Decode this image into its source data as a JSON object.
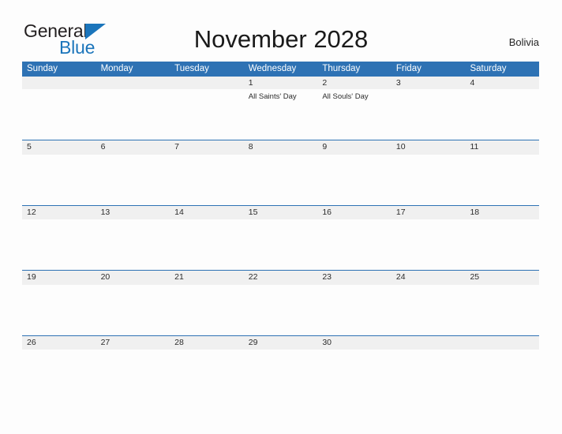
{
  "brand": {
    "name_part1": "General",
    "name_part2": "Blue",
    "triangle_icon": "blue-triangle-icon",
    "color_dark": "#231f20",
    "color_blue": "#1b75bb"
  },
  "header": {
    "title": "November 2028",
    "region": "Bolivia"
  },
  "theme": {
    "header_blue": "#2e72b4",
    "band_gray": "#f0f0f0",
    "page_background": "#fdfdfd",
    "text_dark": "#2b2b2b"
  },
  "calendar": {
    "month": "November",
    "year": "2028",
    "weekdays": [
      "Sunday",
      "Monday",
      "Tuesday",
      "Wednesday",
      "Thursday",
      "Friday",
      "Saturday"
    ],
    "weeks": [
      {
        "separated": false,
        "days": [
          {
            "num": "",
            "events": []
          },
          {
            "num": "",
            "events": []
          },
          {
            "num": "",
            "events": []
          },
          {
            "num": "1",
            "events": [
              "All Saints' Day"
            ]
          },
          {
            "num": "2",
            "events": [
              "All Souls' Day"
            ]
          },
          {
            "num": "3",
            "events": []
          },
          {
            "num": "4",
            "events": []
          }
        ]
      },
      {
        "separated": true,
        "days": [
          {
            "num": "5",
            "events": []
          },
          {
            "num": "6",
            "events": []
          },
          {
            "num": "7",
            "events": []
          },
          {
            "num": "8",
            "events": []
          },
          {
            "num": "9",
            "events": []
          },
          {
            "num": "10",
            "events": []
          },
          {
            "num": "11",
            "events": []
          }
        ]
      },
      {
        "separated": true,
        "days": [
          {
            "num": "12",
            "events": []
          },
          {
            "num": "13",
            "events": []
          },
          {
            "num": "14",
            "events": []
          },
          {
            "num": "15",
            "events": []
          },
          {
            "num": "16",
            "events": []
          },
          {
            "num": "17",
            "events": []
          },
          {
            "num": "18",
            "events": []
          }
        ]
      },
      {
        "separated": true,
        "days": [
          {
            "num": "19",
            "events": []
          },
          {
            "num": "20",
            "events": []
          },
          {
            "num": "21",
            "events": []
          },
          {
            "num": "22",
            "events": []
          },
          {
            "num": "23",
            "events": []
          },
          {
            "num": "24",
            "events": []
          },
          {
            "num": "25",
            "events": []
          }
        ]
      },
      {
        "separated": true,
        "days": [
          {
            "num": "26",
            "events": []
          },
          {
            "num": "27",
            "events": []
          },
          {
            "num": "28",
            "events": []
          },
          {
            "num": "29",
            "events": []
          },
          {
            "num": "30",
            "events": []
          },
          {
            "num": "",
            "events": []
          },
          {
            "num": "",
            "events": []
          }
        ]
      }
    ]
  }
}
